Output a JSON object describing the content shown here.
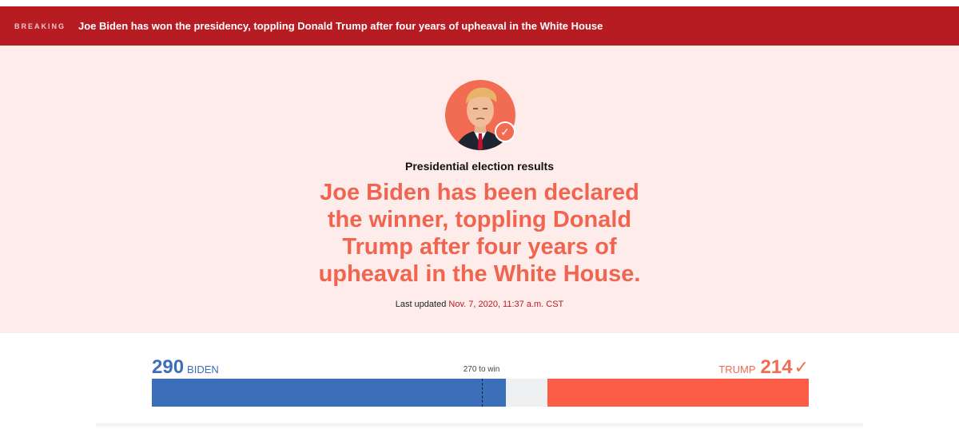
{
  "banner": {
    "label": "BREAKING",
    "headline": "Joe Biden has won the presidency, toppling Donald Trump after four years of upheaval in the White House"
  },
  "hero": {
    "avatar_icon": "trump-portrait-icon",
    "badge_icon": "check-icon",
    "badge_glyph": "✓",
    "kicker": "Presidential election results",
    "headline": "Joe Biden has been declared the winner, toppling Donald Trump after four years of upheaval in the White House.",
    "updated_label": "Last updated",
    "updated_time": "Nov. 7, 2020, 11:37 a.m. CST"
  },
  "tally": {
    "biden_votes": "290",
    "biden_name": "BIDEN",
    "trump_name": "TRUMP",
    "trump_votes": "214",
    "trump_check": "✓",
    "win_label": "270 to win",
    "total_electoral_votes": 538,
    "biden_value": 290,
    "trump_value": 214,
    "win_threshold": 270
  },
  "colors": {
    "banner": "#b81c23",
    "hero_bg": "#fdecea",
    "headline": "#f06450",
    "democrat": "#3b6fba",
    "republican": "#fb5d46",
    "uncalled": "#eef0f2"
  }
}
